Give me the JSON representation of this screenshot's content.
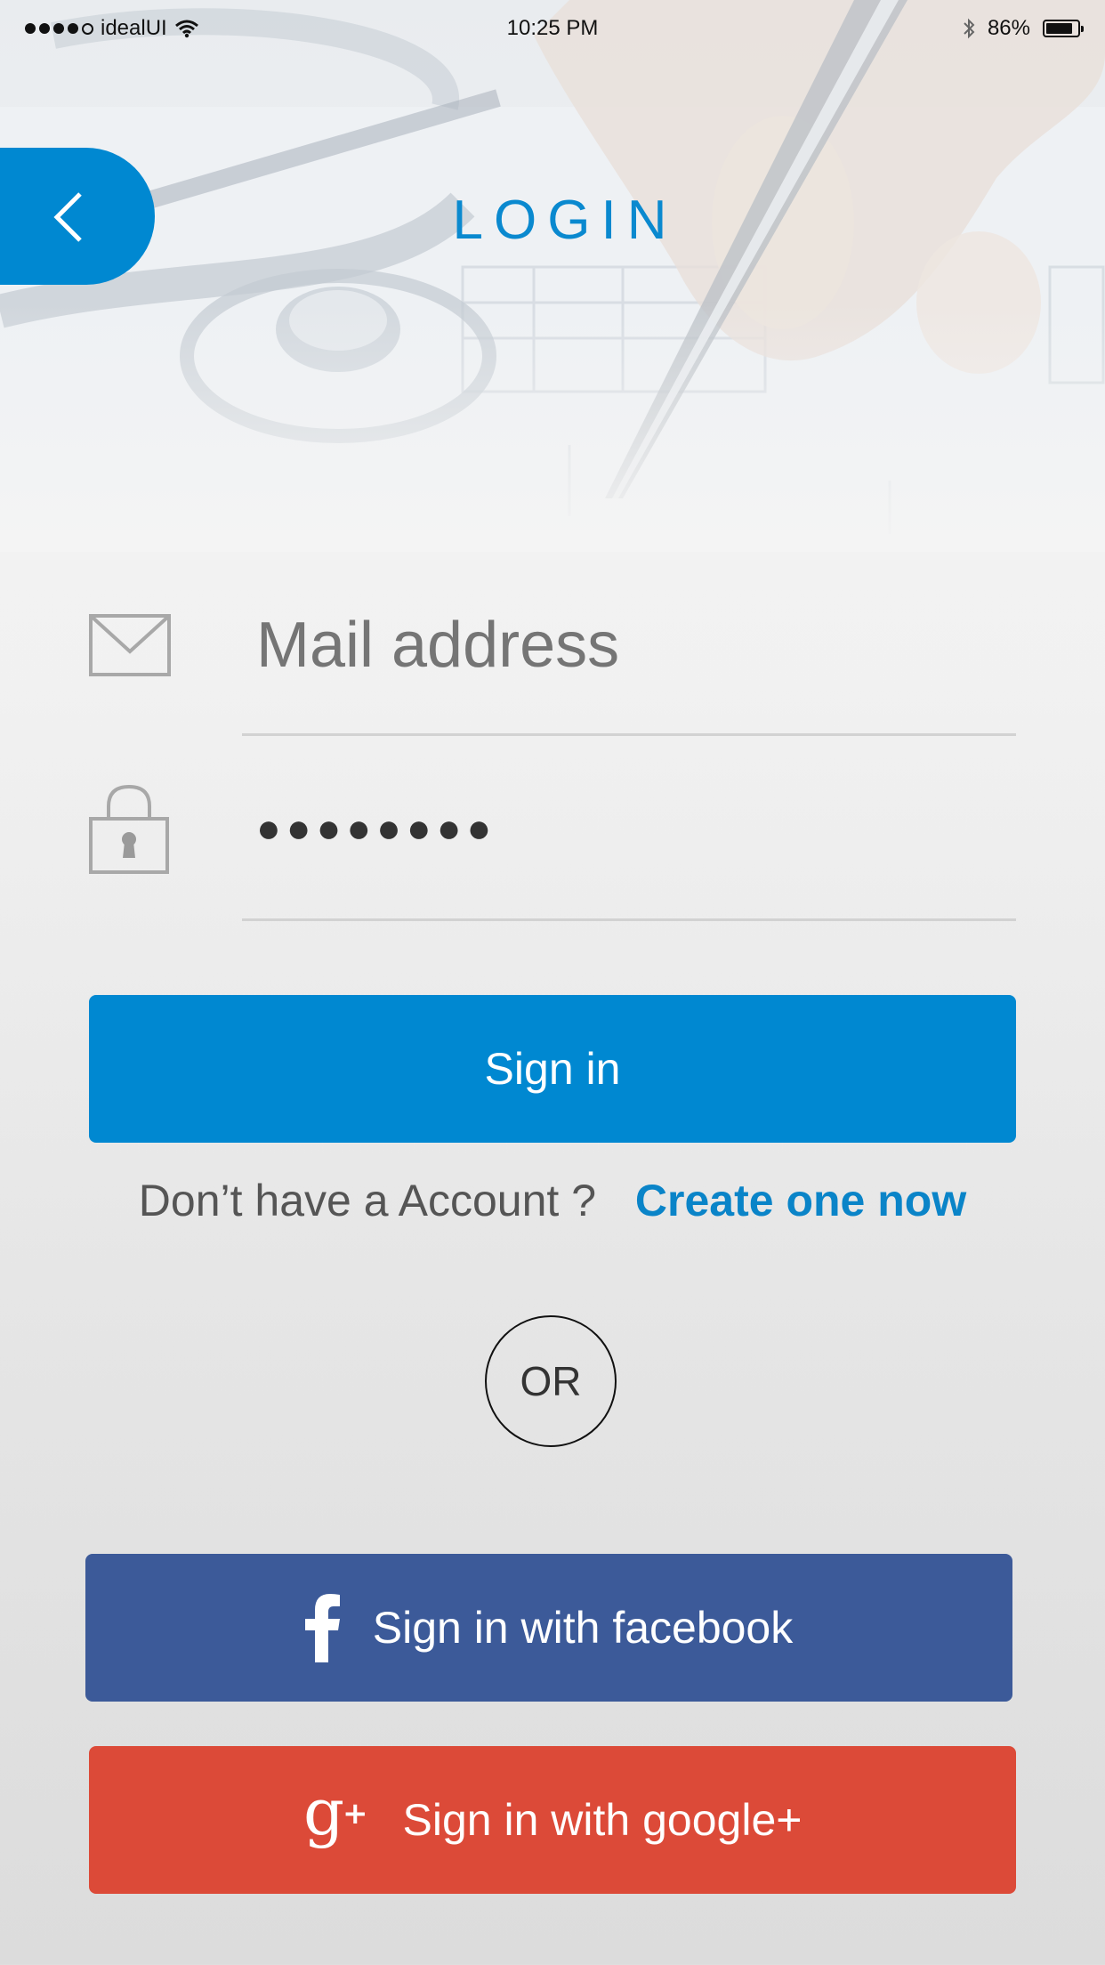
{
  "status_bar": {
    "carrier": "idealUI",
    "time": "10:25 PM",
    "battery": "86%",
    "battery_level": 0.86
  },
  "header": {
    "title": "LOGIN",
    "back_icon": "chevron-left-icon"
  },
  "form": {
    "email": {
      "placeholder": "Mail address",
      "value": "",
      "icon": "mail-icon"
    },
    "password": {
      "value": "●●●●●●●●",
      "icon": "lock-icon"
    },
    "submit_label": "Sign in"
  },
  "signup": {
    "prompt": "Don’t have a Account ?",
    "link": "Create one now"
  },
  "divider_label": "OR",
  "social": {
    "facebook_label": "Sign in with facebook",
    "google_label": "Sign in with google+"
  },
  "colors": {
    "primary": "#0088d1",
    "facebook": "#3c5a99",
    "google": "#dc4a38",
    "link": "#0a84c8"
  }
}
